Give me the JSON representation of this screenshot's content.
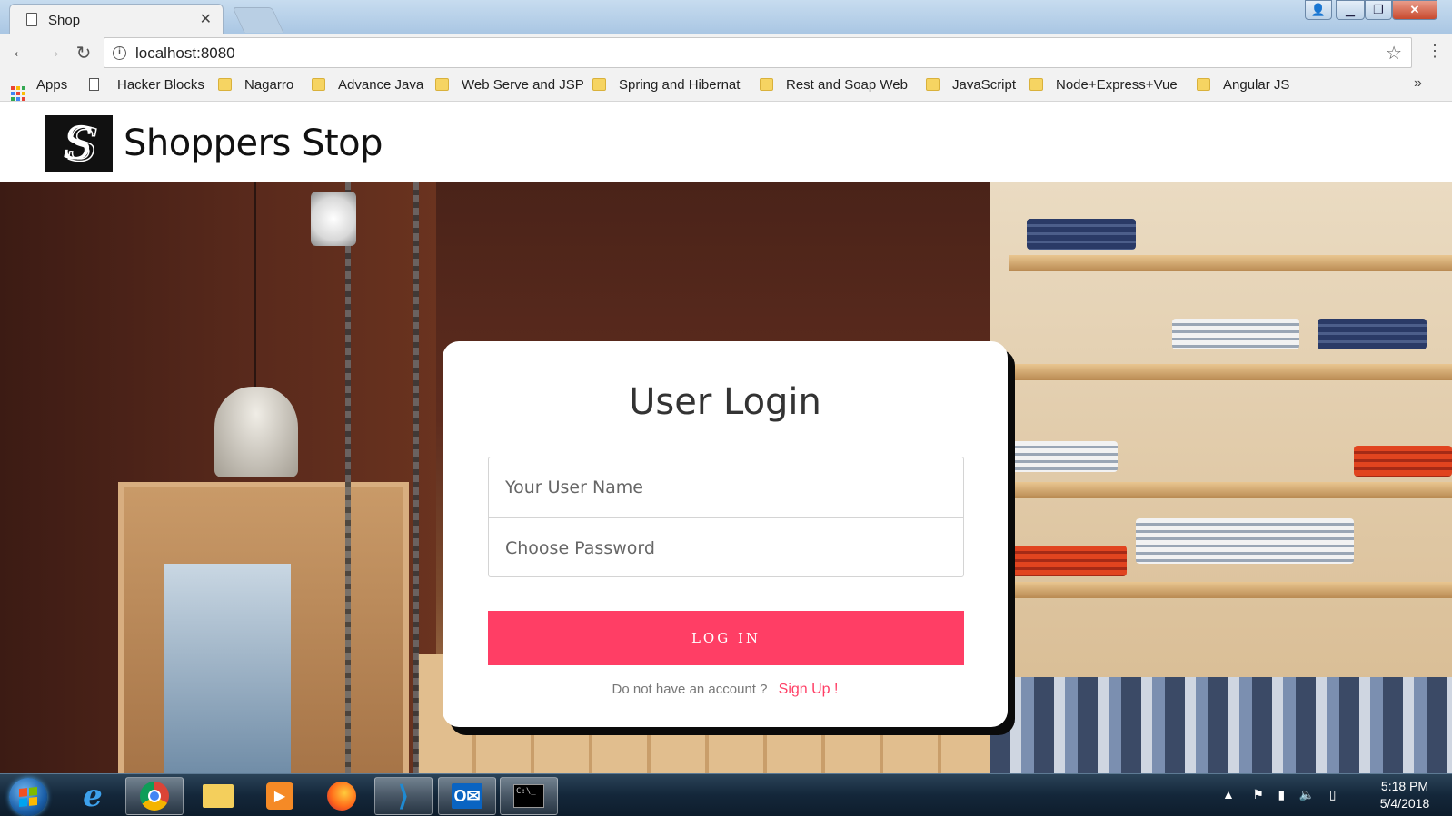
{
  "browser": {
    "tab_title": "Shop",
    "url": "localhost:8080",
    "bookmarks": [
      {
        "label": "Apps"
      },
      {
        "label": "Hacker Blocks"
      },
      {
        "label": "Nagarro"
      },
      {
        "label": "Advance Java"
      },
      {
        "label": "Web Serve and JSP"
      },
      {
        "label": "Spring and Hibernat"
      },
      {
        "label": "Rest and Soap Web"
      },
      {
        "label": "JavaScript"
      },
      {
        "label": "Node+Express+Vue"
      },
      {
        "label": "Angular JS"
      }
    ],
    "overflow_label": "»"
  },
  "header": {
    "brand": "Shoppers Stop",
    "logo_letter": "S"
  },
  "login": {
    "title": "User Login",
    "username_placeholder": "Your User Name",
    "password_placeholder": "Choose Password",
    "login_button": "LOG IN",
    "signup_prompt": "Do not have an account ?",
    "signup_link": "Sign Up !"
  },
  "taskbar": {
    "apps": [
      "Internet Explorer",
      "Google Chrome",
      "File Explorer",
      "Media Player",
      "Firefox",
      "Visual Studio Code",
      "Outlook",
      "Command Prompt"
    ],
    "time": "5:18 PM",
    "date": "5/4/2018"
  },
  "colors": {
    "accent": "#ff3e65",
    "card_shadow": "#0a0a0a"
  }
}
